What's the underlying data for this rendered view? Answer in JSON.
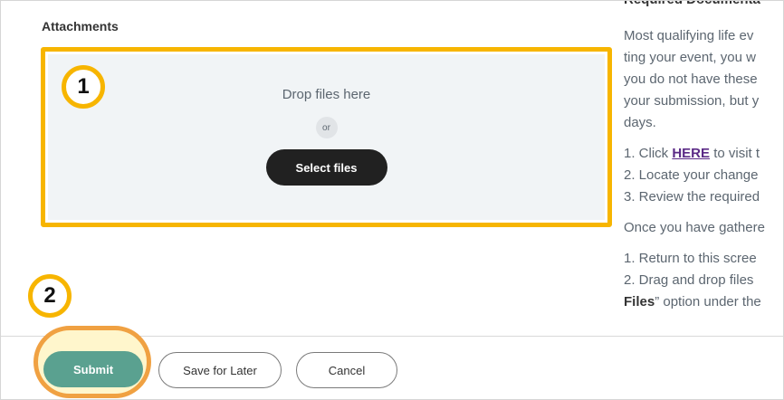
{
  "attachments": {
    "label": "Attachments",
    "drop_text": "Drop files here",
    "or_text": "or",
    "select_files_label": "Select files"
  },
  "callouts": {
    "one": "1",
    "two": "2"
  },
  "instructions": {
    "heading": "Required Documenta",
    "para1": [
      "Most qualifying life ev",
      "ting your event, you w",
      "you do not have these",
      "your submission, but y",
      "days."
    ],
    "steps1": {
      "s1_prefix": "1. Click ",
      "s1_link": "HERE",
      "s1_suffix": " to visit t",
      "s2": "2. Locate your change",
      "s3": "3. Review the required"
    },
    "para2": "Once you have gathere",
    "steps2": {
      "s1": "1. Return to this scree",
      "s2": "2. Drag and drop files",
      "s3_bold": "Files",
      "s3_rest": "” option under the"
    }
  },
  "actions": {
    "submit_label": "Submit",
    "save_later_label": "Save for Later",
    "cancel_label": "Cancel"
  },
  "colors": {
    "highlight": "#f7b500",
    "submit": "#5aa190",
    "link": "#5b2a86"
  }
}
